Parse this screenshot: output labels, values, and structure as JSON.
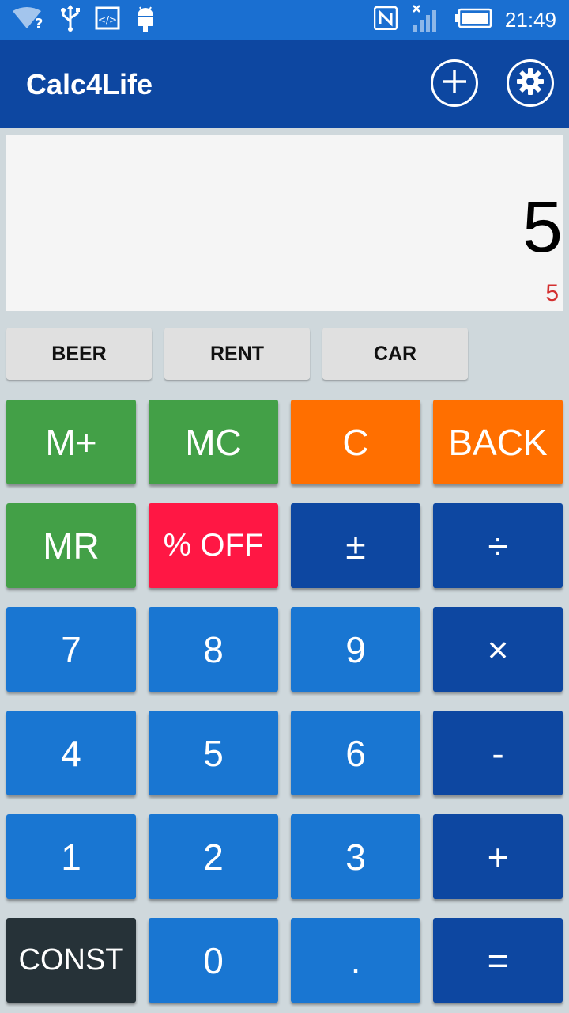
{
  "status_bar": {
    "time": "21:49",
    "icons": [
      "wifi-unknown-icon",
      "usb-icon",
      "developer-code-icon",
      "android-icon",
      "nfc-icon",
      "no-signal-icon",
      "battery-icon"
    ]
  },
  "app_bar": {
    "title": "Calc4Life",
    "actions": [
      "add-circle-icon",
      "settings-icon"
    ]
  },
  "display": {
    "main_value": "5",
    "secondary_value": "5"
  },
  "presets": [
    "BEER",
    "RENT",
    "CAR"
  ],
  "keypad": {
    "m_plus": "M+",
    "mc": "MC",
    "clear": "C",
    "back": "BACK",
    "mr": "MR",
    "percent_off": "% OFF",
    "plus_minus": "±",
    "divide": "÷",
    "seven": "7",
    "eight": "8",
    "nine": "9",
    "multiply": "×",
    "four": "4",
    "five": "5",
    "six": "6",
    "minus": "-",
    "one": "1",
    "two": "2",
    "three": "3",
    "plus": "+",
    "const": "CONST",
    "zero": "0",
    "dot": ".",
    "equals": "="
  },
  "colors": {
    "status_bar": "#1a6fd1",
    "app_bar": "#0d47a1",
    "memory_keys": "#43a047",
    "clear_keys": "#ff6f00",
    "percent_off_key": "#ff1744",
    "operator_keys": "#0d47a1",
    "digit_keys": "#1976d2",
    "const_key": "#263238",
    "secondary_value": "#d32f2f"
  }
}
